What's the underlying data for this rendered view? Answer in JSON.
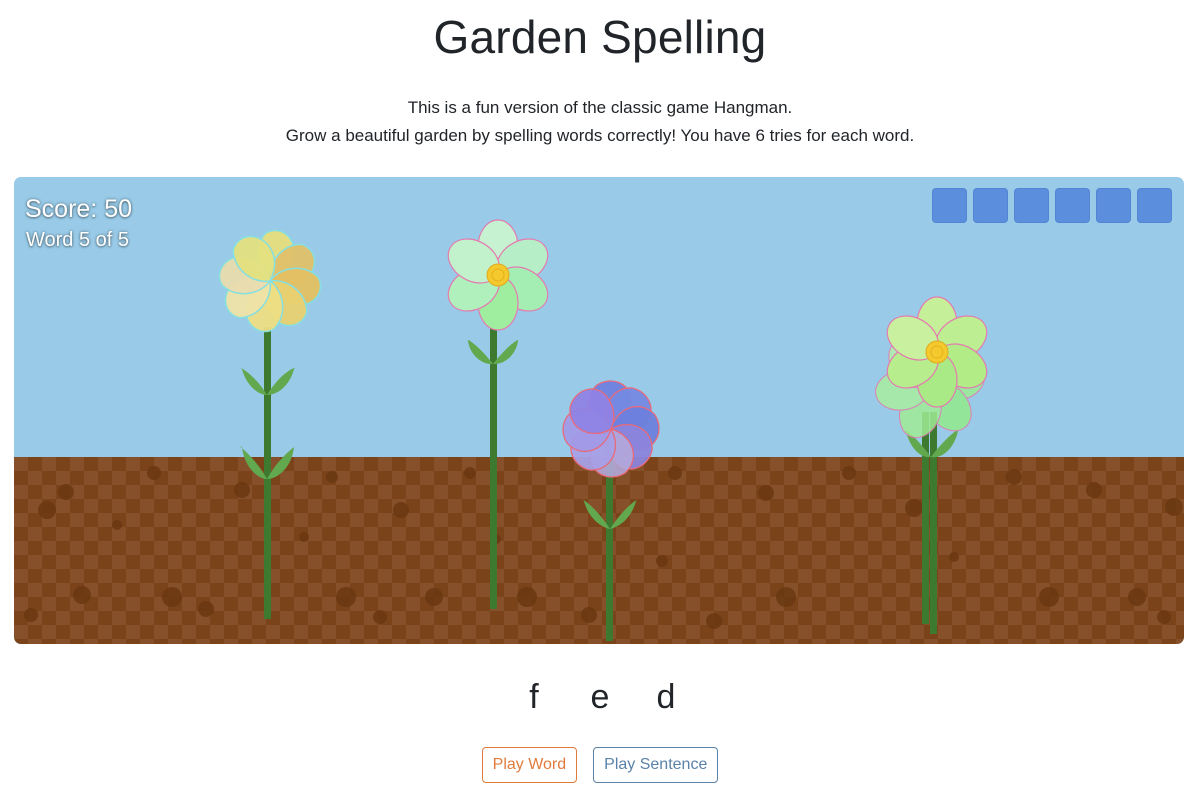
{
  "header": {
    "title": "Garden Spelling",
    "intro_line_1": "This is a fun version of the classic game Hangman.",
    "intro_line_2": "Grow a beautiful garden by spelling words correctly! You have 6 tries for each word."
  },
  "game": {
    "score_label": "Score: 50",
    "word_progress": "Word 5 of 5",
    "tries_remaining": 6,
    "letters": [
      "f",
      "e",
      "d"
    ],
    "colors": {
      "sky": "#99cbe8",
      "soil": "#7b4319",
      "try_box": "#5b8fdd",
      "stem": "#3d7a2f",
      "leaf": "#62a84e"
    },
    "flowers": [
      {
        "name": "yellow-pinwheel-flower",
        "colors": [
          "#e8e08a",
          "#e3c063",
          "#eedc98",
          "#dfc06a"
        ]
      },
      {
        "name": "green-daisy-flower",
        "colors": [
          "#bff0c9",
          "#9eefa9"
        ]
      },
      {
        "name": "purple-pinwheel-flower",
        "colors": [
          "#7d86e3",
          "#a29ae7"
        ]
      },
      {
        "name": "lime-daisy-flower",
        "colors": [
          "#c5ef99",
          "#a9ea86"
        ]
      }
    ]
  },
  "controls": {
    "play_word": "Play Word",
    "play_sentence": "Play Sentence"
  }
}
